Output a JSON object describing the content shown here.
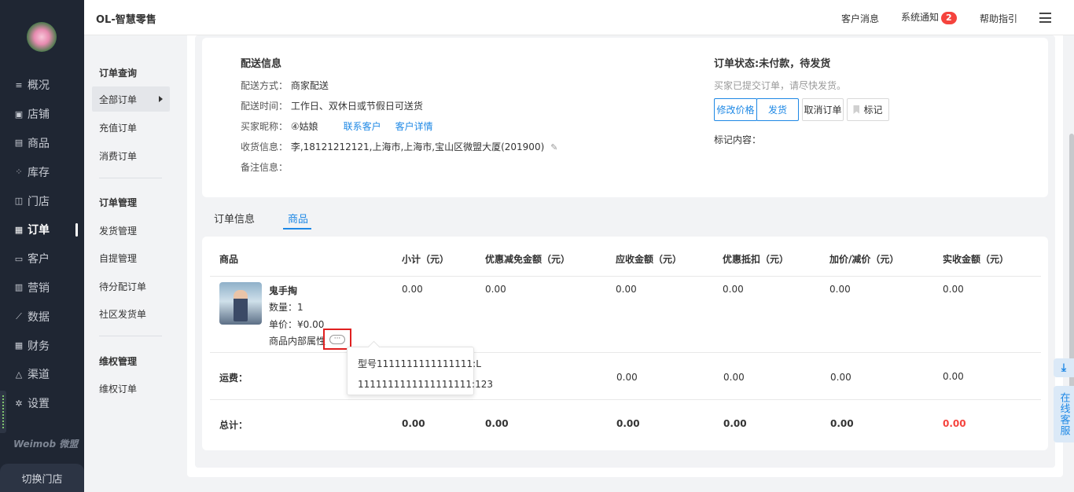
{
  "app": {
    "title": "OL-智慧零售"
  },
  "header": {
    "customer_msg": "客户消息",
    "system_notice": "系统通知",
    "notice_count": "2",
    "help": "帮助指引"
  },
  "sidebar": {
    "items": [
      {
        "label": "概况",
        "icon": "overview-icon"
      },
      {
        "label": "店铺",
        "icon": "store-icon"
      },
      {
        "label": "商品",
        "icon": "goods-icon"
      },
      {
        "label": "库存",
        "icon": "inventory-icon"
      },
      {
        "label": "门店",
        "icon": "shop-icon"
      },
      {
        "label": "订单",
        "icon": "order-icon"
      },
      {
        "label": "客户",
        "icon": "customer-icon"
      },
      {
        "label": "营销",
        "icon": "marketing-icon"
      },
      {
        "label": "数据",
        "icon": "data-icon"
      },
      {
        "label": "财务",
        "icon": "finance-icon"
      },
      {
        "label": "渠道",
        "icon": "channel-icon"
      },
      {
        "label": "设置",
        "icon": "settings-icon"
      }
    ],
    "brand": "Weimob 微盟",
    "switch_store": "切换门店"
  },
  "subnav": {
    "group1": "订单查询",
    "all_orders": "全部订单",
    "recharge": "充值订单",
    "consume": "消费订单",
    "group2": "订单管理",
    "delivery": "发货管理",
    "pickup": "自提管理",
    "to_assign": "待分配订单",
    "community": "社区发货单",
    "group3": "维权管理",
    "rights": "维权订单"
  },
  "shipping": {
    "title": "配送信息",
    "method_label": "配送方式：",
    "method": "商家配送",
    "time_label": "配送时间：",
    "time": "工作日、双休日或节假日可送货",
    "buyer_label": "买家昵称：",
    "buyer": "④姑娘",
    "contact_link": "联系客户",
    "detail_link": "客户详情",
    "address_label": "收货信息：",
    "address": "李,18121212121,上海市,上海市,宝山区微盟大厦(201900)",
    "remark_label": "备注信息："
  },
  "status": {
    "title": "订单状态:未付款，待发货",
    "desc": "买家已提交订单，请尽快发货。",
    "btn_modify_price": "修改价格",
    "btn_ship": "发货",
    "btn_cancel": "取消订单",
    "btn_mark": "标记",
    "mark_content": "标记内容："
  },
  "tabs": {
    "order_info": "订单信息",
    "goods": "商品"
  },
  "table": {
    "headers": [
      "商品",
      "小计（元）",
      "优惠减免金额（元）",
      "应收金额（元）",
      "优惠抵扣（元）",
      "加价/减价（元）",
      "实收金额（元）"
    ],
    "product": {
      "name": "鬼手掏",
      "qty": "数量：1",
      "price": "单价：¥0.00",
      "attr": "商品内部属性",
      "ellipsis": "···",
      "values": [
        "0.00",
        "0.00",
        "0.00",
        "0.00",
        "0.00",
        "0.00"
      ]
    },
    "freight": {
      "label": "运费：",
      "values": [
        "0.00",
        "0.00",
        "0.00",
        "0.00"
      ]
    },
    "total": {
      "label": "总计：",
      "values": [
        "0.00",
        "0.00",
        "0.00",
        "0.00",
        "0.00",
        "0.00"
      ]
    }
  },
  "popover": {
    "line1": "型号1111111111111111:L",
    "line2": "1111111111111111111:123"
  },
  "widgets": {
    "online_service": "在线客服"
  }
}
